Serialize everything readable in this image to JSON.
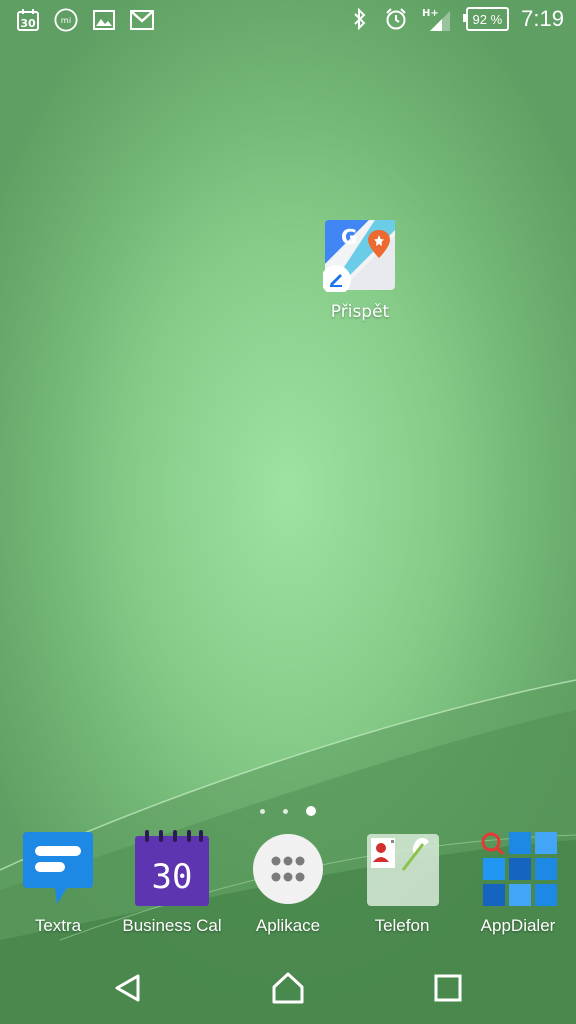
{
  "status_bar": {
    "calendar_day": "30",
    "mi_badge": "mi",
    "network_type": "H+",
    "battery_percent": "92 %",
    "time": "7:19"
  },
  "home": {
    "desktop_apps": [
      {
        "label": "Přispět"
      }
    ],
    "page_indicator": {
      "pages": 3,
      "active": 3
    }
  },
  "dock": {
    "apps": [
      {
        "label": "Textra"
      },
      {
        "label": "Business Cal"
      },
      {
        "label": "Aplikace"
      },
      {
        "label": "Telefon"
      },
      {
        "label": "AppDialer"
      }
    ],
    "calendar_icon_day": "30"
  },
  "colors": {
    "textra_blue": "#1e88e5",
    "calendar_purple": "#5e35b1",
    "appdialer_blue": "#2196f3",
    "wallpaper_center": "#9fe2a2"
  },
  "icons": {
    "nav_back": "back-triangle-icon",
    "nav_home": "home-icon",
    "nav_recents": "recents-square-icon"
  }
}
